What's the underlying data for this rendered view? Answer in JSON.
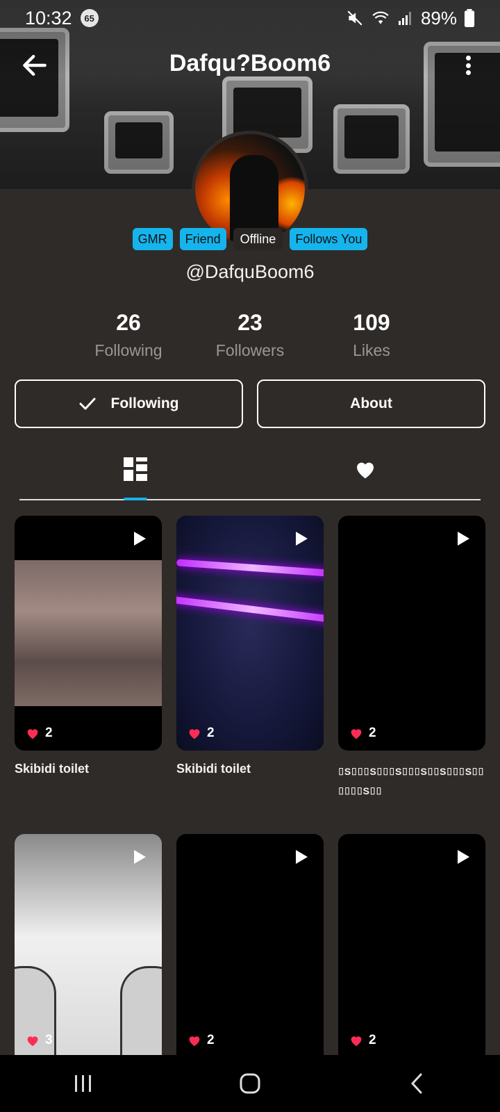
{
  "status_bar": {
    "time": "10:32",
    "notification_badge": "65",
    "battery": "89%"
  },
  "header": {
    "title": "Dafqu?Boom6"
  },
  "profile": {
    "badges": [
      "GMR",
      "Friend",
      "Offline",
      "Follows You"
    ],
    "handle": "@DafquBoom6",
    "stats": [
      {
        "value": "26",
        "label": "Following"
      },
      {
        "value": "23",
        "label": "Followers"
      },
      {
        "value": "109",
        "label": "Likes"
      }
    ]
  },
  "actions": {
    "following_label": "Following",
    "about_label": "About"
  },
  "videos": [
    {
      "likes": "2",
      "caption": "Skibidi toilet"
    },
    {
      "likes": "2",
      "caption": "Skibidi toilet"
    },
    {
      "likes": "2",
      "caption": "⌷S⌷⌷⌷S⌷⌷⌷S⌷⌷⌷S⌷⌷S⌷⌷⌷S⌷⌷⌷⌷⌷⌷S⌷⌷"
    },
    {
      "likes": "3",
      "caption": ""
    },
    {
      "likes": "2",
      "caption": ""
    },
    {
      "likes": "2",
      "caption": ""
    }
  ],
  "colors": {
    "accent": "#15b4ec",
    "background": "#2f2b28",
    "heart": "#ff2d55"
  }
}
